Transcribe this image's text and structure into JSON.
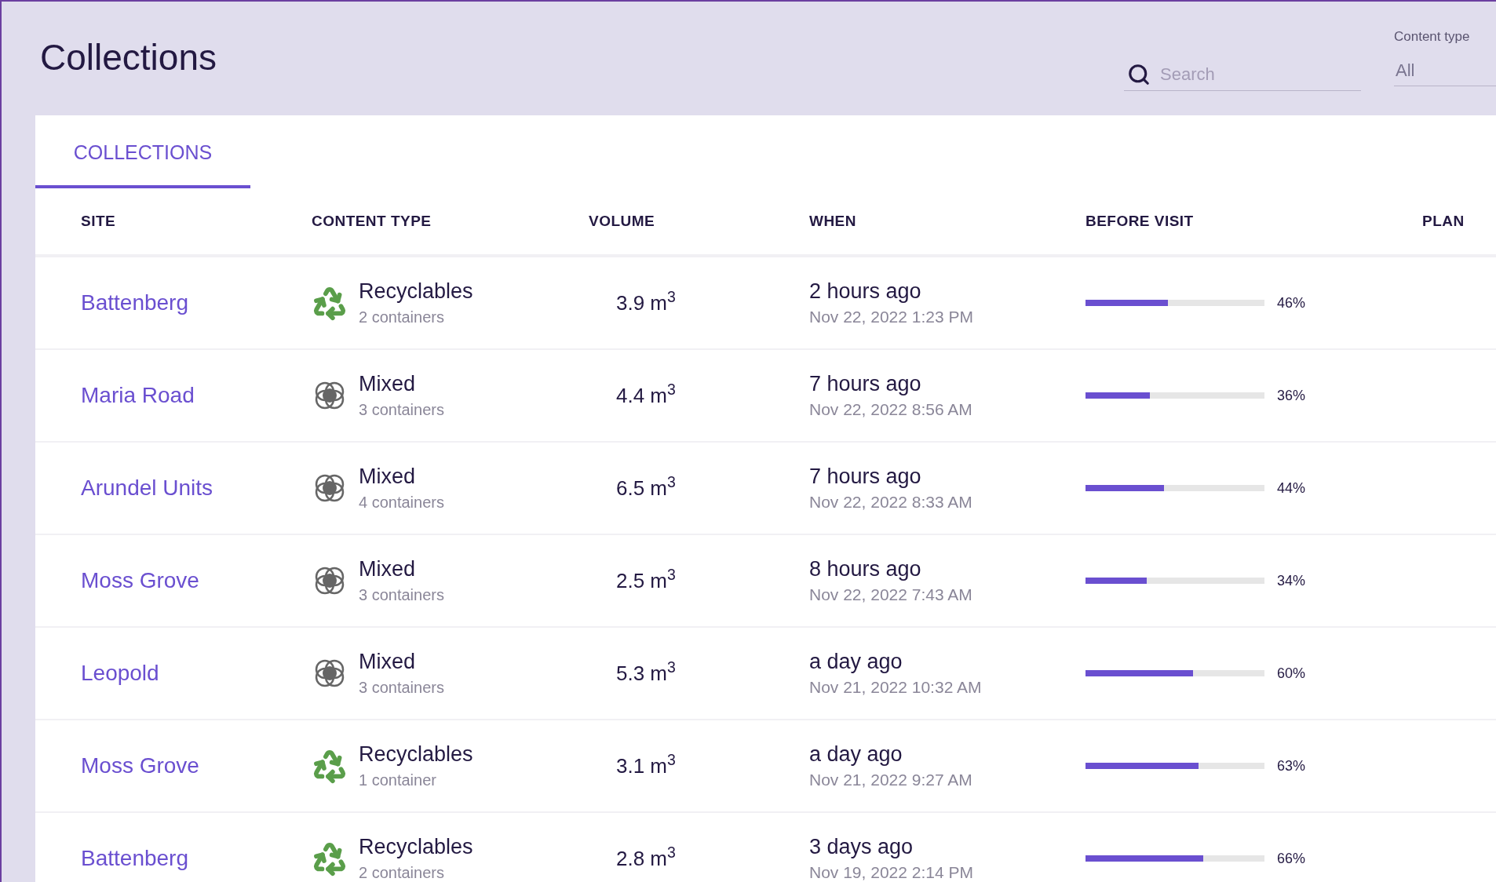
{
  "page": {
    "title": "Collections"
  },
  "search": {
    "placeholder": "Search"
  },
  "content_type_filter": {
    "label": "Content type",
    "value": "All"
  },
  "tabs": [
    {
      "label": "COLLECTIONS",
      "selected": true
    }
  ],
  "table": {
    "columns": [
      "SITE",
      "CONTENT TYPE",
      "VOLUME",
      "WHEN",
      "BEFORE VISIT",
      "PLAN"
    ],
    "rows": [
      {
        "site": "Battenberg",
        "kind": "recyclables",
        "content_type": "Recyclables",
        "containers": "2 containers",
        "volume": "3.9 m$^{3}$",
        "when": "2 hours ago",
        "date": "Nov 22, 2022 1:23 PM",
        "level": 0.46,
        "reading": "46%"
      },
      {
        "site": "Maria Road",
        "kind": "mixed",
        "content_type": "Mixed",
        "containers": "3 containers",
        "volume": "4.4 m$^{3}$",
        "when": "7 hours ago",
        "date": "Nov 22, 2022 8:56 AM",
        "level": 0.36,
        "reading": "36%"
      },
      {
        "site": "Arundel Units",
        "kind": "mixed",
        "content_type": "Mixed",
        "containers": "4 containers",
        "volume": "6.5 m$^{3}$",
        "when": "7 hours ago",
        "date": "Nov 22, 2022 8:33 AM",
        "level": 0.44,
        "reading": "44%"
      },
      {
        "site": "Moss Grove",
        "kind": "mixed",
        "content_type": "Mixed",
        "containers": "3 containers",
        "volume": "2.5 m$^{3}$",
        "when": "8 hours ago",
        "date": "Nov 22, 2022 7:43 AM",
        "level": 0.34,
        "reading": "34%"
      },
      {
        "site": "Leopold",
        "kind": "mixed",
        "content_type": "Mixed",
        "containers": "3 containers",
        "volume": "5.3 m$^{3}$",
        "when": "a day ago",
        "date": "Nov 21, 2022 10:32 AM",
        "level": 0.6,
        "reading": "60%"
      },
      {
        "site": "Moss Grove",
        "kind": "recyclables",
        "content_type": "Recyclables",
        "containers": "1 container",
        "volume": "3.1 m$^{3}$",
        "when": "a day ago",
        "date": "Nov 21, 2022 9:27 AM",
        "level": 0.63,
        "reading": "63%"
      },
      {
        "site": "Battenberg",
        "kind": "recyclables",
        "content_type": "Recyclables",
        "containers": "2 containers",
        "volume": "2.8 m$^{3}$",
        "when": "3 days ago",
        "date": "Nov 19, 2022 2:14 PM",
        "level": 0.66,
        "reading": "66%"
      }
    ]
  }
}
